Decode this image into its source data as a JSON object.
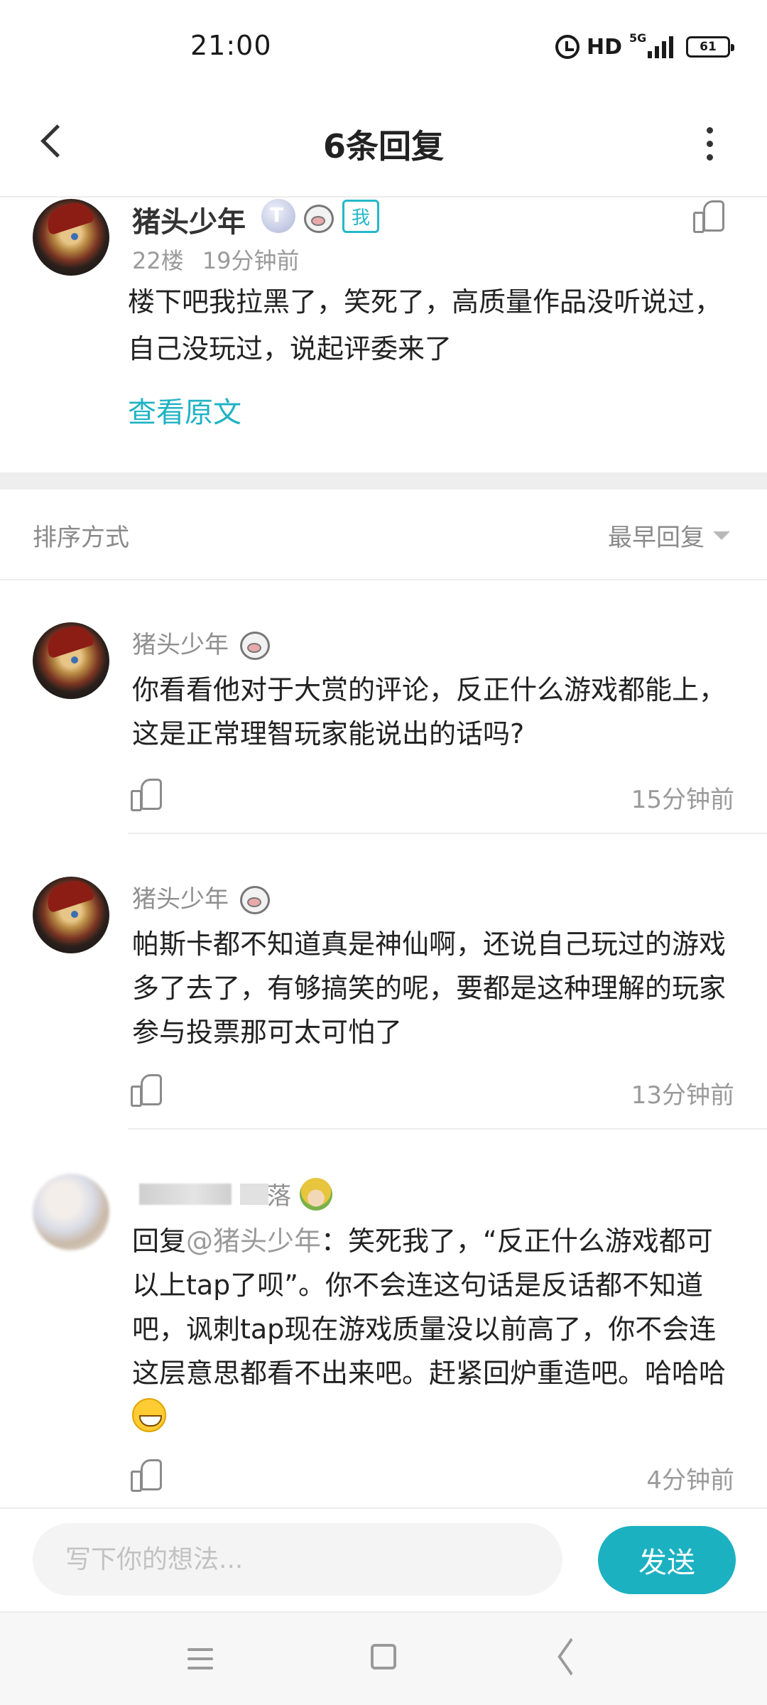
{
  "status_bar": {
    "time": "21:00",
    "network": "HD",
    "signal_tag": "5G",
    "battery": "61"
  },
  "header": {
    "title": "6条回复"
  },
  "top_comment": {
    "author": "猪头少年",
    "level_badge": "T",
    "me_badge": "我",
    "floor": "22楼",
    "time": "19分钟前",
    "text": "楼下吧我拉黑了，笑死了，高质量作品没听说过，自己没玩过，说起评委来了",
    "view_original": "查看原文"
  },
  "sort": {
    "label": "排序方式",
    "value": "最早回复"
  },
  "replies": [
    {
      "author": "猪头少年",
      "text": "你看看他对于大赏的评论，反正什么游戏都能上，这是正常理智玩家能说出的话吗?",
      "time": "15分钟前"
    },
    {
      "author": "猪头少年",
      "text": "帕斯卡都不知道真是神仙啊，还说自己玩过的游戏多了去了，有够搞笑的呢，要都是这种理解的玩家参与投票那可太可怕了",
      "time": "13分钟前"
    },
    {
      "author_visible_suffix": "落",
      "reply_prefix": "回复",
      "mention": "@猪头少年",
      "text": "：笑死我了，“反正什么游戏都可以上tap了呗”。你不会连这句话是反话都不知道吧，讽刺tap现在游戏质量没以前高了，你不会连这层意思都看不出来吧。赶紧回炉重造吧。哈哈哈",
      "time": "4分钟前"
    }
  ],
  "composer": {
    "placeholder": "写下你的想法...",
    "send_label": "发送"
  },
  "colors": {
    "accent": "#1bb1c1",
    "link": "#1fb3c4"
  }
}
